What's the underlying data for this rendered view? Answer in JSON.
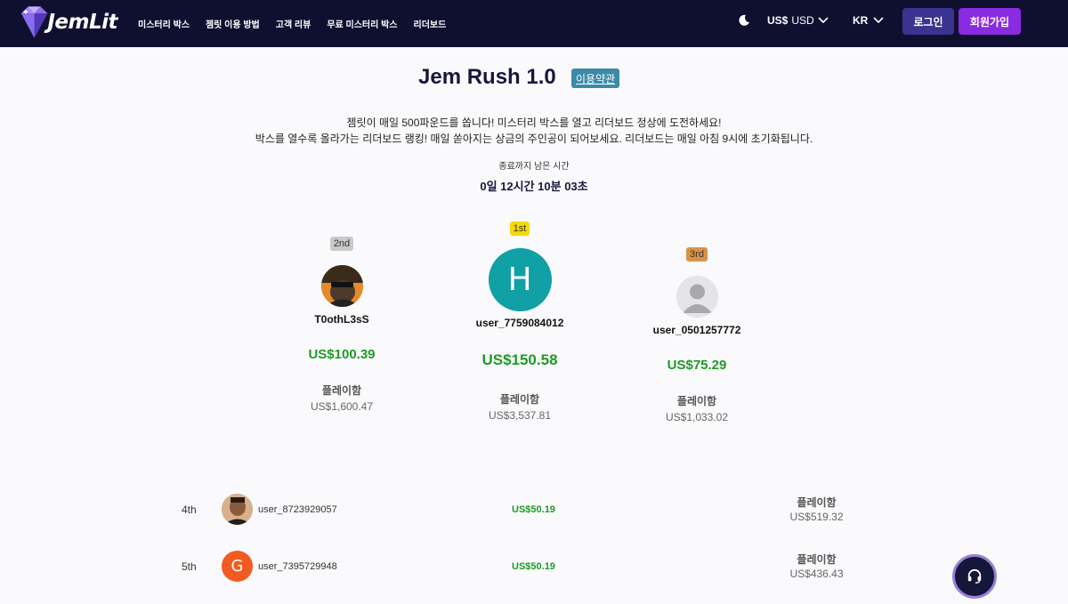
{
  "header": {
    "logo_text": "JemLit",
    "nav": [
      "미스터리 박스",
      "젬릿 이용 방법",
      "고객 리뷰",
      "무료 미스터리 박스",
      "리더보드"
    ],
    "currency_symbol": "US$",
    "currency_code": "USD",
    "language": "KR",
    "login_label": "로그인",
    "signup_label": "회원가입"
  },
  "page": {
    "title": "Jem Rush 1.0",
    "terms_label": "이용약관",
    "description_line1": "젬릿이 매일 500파운드를 쏩니다! 미스터리 박스를 열고 리더보드 정상에 도전하세요!",
    "description_line2": "박스를 열수록 올라가는 리더보드 랭킹! 매일 쏟아지는 상금의 주인공이 되어보세요. 리더보드는 매일 아침 9시에 초기화됩니다.",
    "countdown_label": "종료까지 남은 시간",
    "countdown_value": "0일 12시간 10분 03초"
  },
  "podium": {
    "first": {
      "rank": "1st",
      "avatar_letter": "H",
      "username": "user_7759084012",
      "prize": "US$150.58",
      "played_label": "플레이함",
      "played_value": "US$3,537.81"
    },
    "second": {
      "rank": "2nd",
      "username": "T0othL3sS",
      "prize": "US$100.39",
      "played_label": "플레이함",
      "played_value": "US$1,600.47"
    },
    "third": {
      "rank": "3rd",
      "username": "user_0501257772",
      "prize": "US$75.29",
      "played_label": "플레이함",
      "played_value": "US$1,033.02"
    }
  },
  "rows": [
    {
      "rank": "4th",
      "username": "user_8723929057",
      "prize": "US$50.19",
      "played_label": "플레이함",
      "played_value": "US$519.32"
    },
    {
      "rank": "5th",
      "avatar_letter": "G",
      "username": "user_7395729948",
      "prize": "US$50.19",
      "played_label": "플레이함",
      "played_value": "US$436.43"
    }
  ],
  "colors": {
    "header_bg": "#0f1030",
    "prize_green": "#1f9a25",
    "first_badge": "#f5d90a",
    "second_badge": "#c9c9c9",
    "third_badge": "#d99345",
    "first_avatar": "#10a0a6",
    "g_avatar": "#f25a22",
    "login_bg": "#3b3390",
    "signup_bg": "#8a2be2",
    "terms_bg": "#3c8aa8"
  }
}
